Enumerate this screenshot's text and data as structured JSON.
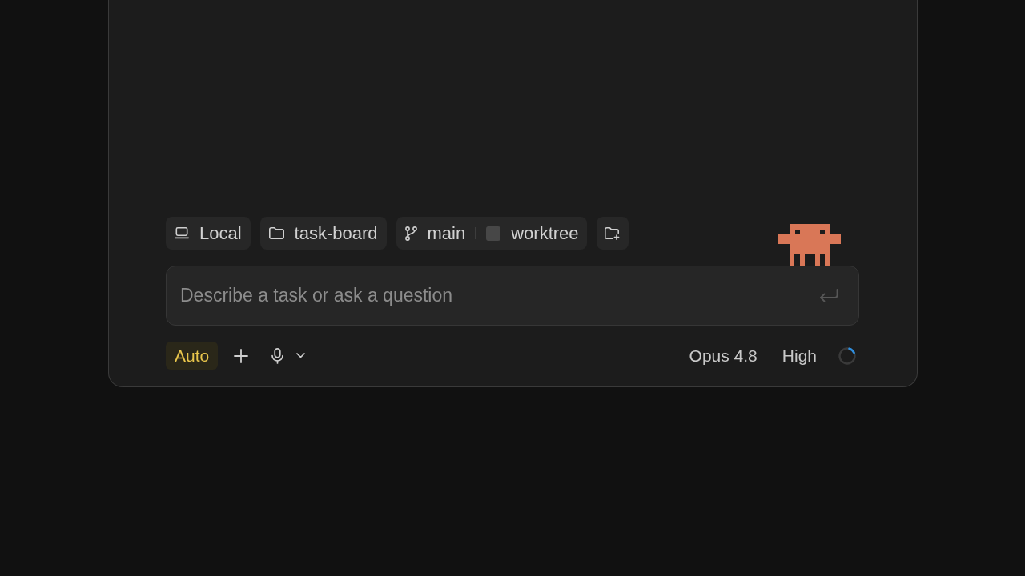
{
  "context_chips": [
    {
      "kind": "environment",
      "label": "Local"
    },
    {
      "kind": "folder",
      "label": "task-board"
    },
    {
      "kind": "branch",
      "label": "main",
      "worktree": "worktree"
    },
    {
      "kind": "add_folder"
    }
  ],
  "prompt": {
    "placeholder": "Describe a task or ask a question"
  },
  "toolbar": {
    "mode": "Auto",
    "model": "Opus 4.8",
    "effort": "High"
  }
}
